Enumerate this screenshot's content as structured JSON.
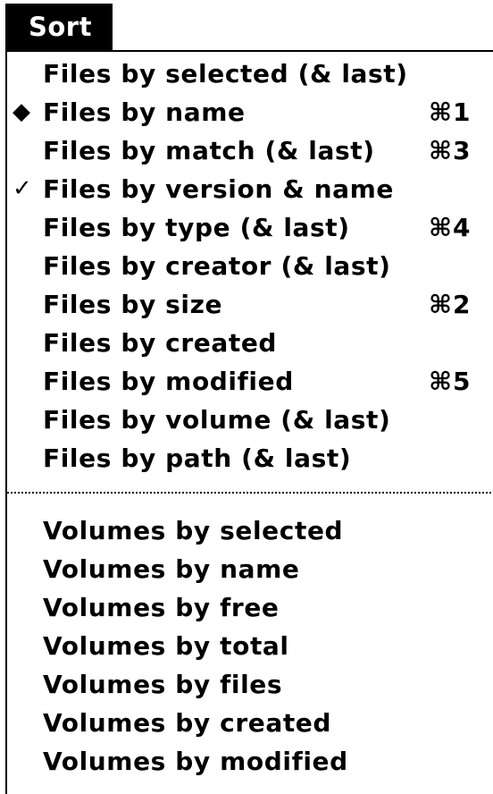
{
  "menu": {
    "title": "Sort",
    "file_items": [
      {
        "mark": "",
        "label": "Files by selected (& last)",
        "shortcut": ""
      },
      {
        "mark": "◆",
        "label": "Files by name",
        "shortcut": "⌘1"
      },
      {
        "mark": "",
        "label": "Files by match  (& last)",
        "shortcut": "⌘3"
      },
      {
        "mark": "✓",
        "label": "Files by version & name",
        "shortcut": ""
      },
      {
        "mark": "",
        "label": "Files by type  (& last)",
        "shortcut": "⌘4"
      },
      {
        "mark": "",
        "label": "Files by creator  (& last)",
        "shortcut": ""
      },
      {
        "mark": "",
        "label": "Files by size",
        "shortcut": "⌘2"
      },
      {
        "mark": "",
        "label": "Files by created",
        "shortcut": ""
      },
      {
        "mark": "",
        "label": "Files by modified",
        "shortcut": "⌘5"
      },
      {
        "mark": "",
        "label": "Files by volume  (& last)",
        "shortcut": ""
      },
      {
        "mark": "",
        "label": "Files by path  (& last)",
        "shortcut": ""
      }
    ],
    "volume_items": [
      {
        "label": "Volumes by selected"
      },
      {
        "label": "Volumes by name"
      },
      {
        "label": "Volumes by free"
      },
      {
        "label": "Volumes by total"
      },
      {
        "label": "Volumes by files"
      },
      {
        "label": "Volumes by created"
      },
      {
        "label": "Volumes by modified"
      }
    ]
  }
}
